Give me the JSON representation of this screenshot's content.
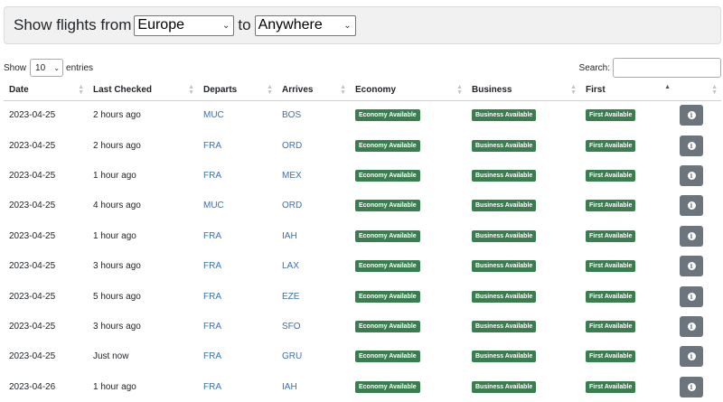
{
  "filter": {
    "prefix": "Show flights from",
    "from_value": "Europe",
    "to_label": "to",
    "to_value": "Anywhere"
  },
  "table_controls": {
    "show_label": "Show",
    "entries_value": "10",
    "entries_label": "entries",
    "search_label": "Search:",
    "search_value": ""
  },
  "columns": [
    "Date",
    "Last Checked",
    "Departs",
    "Arrives",
    "Economy",
    "Business",
    "First",
    ""
  ],
  "sorted_column": "First",
  "sort_direction": "ascending",
  "badges": {
    "economy": "Economy Available",
    "business": "Business Available",
    "first": "First Available",
    "color": "#3a7d4f"
  },
  "info_icon": "info-circle-icon",
  "rows": [
    {
      "date": "2023-04-25",
      "checked": "2 hours ago",
      "departs": "MUC",
      "arrives": "BOS"
    },
    {
      "date": "2023-04-25",
      "checked": "2 hours ago",
      "departs": "FRA",
      "arrives": "ORD"
    },
    {
      "date": "2023-04-25",
      "checked": "1 hour ago",
      "departs": "FRA",
      "arrives": "MEX"
    },
    {
      "date": "2023-04-25",
      "checked": "4 hours ago",
      "departs": "MUC",
      "arrives": "ORD"
    },
    {
      "date": "2023-04-25",
      "checked": "1 hour ago",
      "departs": "FRA",
      "arrives": "IAH"
    },
    {
      "date": "2023-04-25",
      "checked": "3 hours ago",
      "departs": "FRA",
      "arrives": "LAX"
    },
    {
      "date": "2023-04-25",
      "checked": "5 hours ago",
      "departs": "FRA",
      "arrives": "EZE"
    },
    {
      "date": "2023-04-25",
      "checked": "3 hours ago",
      "departs": "FRA",
      "arrives": "SFO"
    },
    {
      "date": "2023-04-25",
      "checked": "Just now",
      "departs": "FRA",
      "arrives": "GRU"
    },
    {
      "date": "2023-04-26",
      "checked": "1 hour ago",
      "departs": "FRA",
      "arrives": "IAH"
    }
  ]
}
